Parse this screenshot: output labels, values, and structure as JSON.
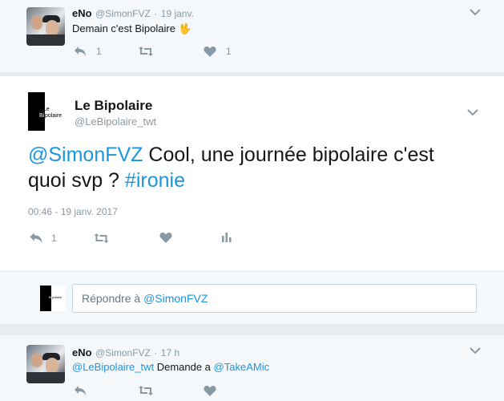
{
  "tweet_prev": {
    "name": "eNo",
    "handle": "@SimonFVZ",
    "sep": "·",
    "date": "19 janv.",
    "text": "Demain c'est Bipolaire",
    "emoji": "🖖",
    "reply_count": "1",
    "like_count": "1"
  },
  "tweet_main": {
    "name": "Le Bipolaire",
    "handle": "@LeBipolaire_twt",
    "avatar_text_white": "Le",
    "avatar_text_split_left": "Bi",
    "avatar_text_split_right": "polaire",
    "mention": "@SimonFVZ",
    "text": " Cool, une journée bipolaire c'est quoi svp ? ",
    "hashtag": "#ironie",
    "timestamp": "00:46 - 19 janv. 2017",
    "reply_count": "1"
  },
  "reply": {
    "prefix": "Répondre à ",
    "mention": "@SimonFVZ"
  },
  "tweet_next": {
    "name": "eNo",
    "handle": "@SimonFVZ",
    "sep": "·",
    "date": "17 h",
    "mention1": "@LeBipolaire_twt",
    "text": " Demande a ",
    "mention2": "@TakeAMic"
  },
  "icons": [
    "reply-icon",
    "retweet-icon",
    "heart-icon",
    "analytics-icon",
    "chevron-down-icon"
  ],
  "colors": {
    "link": "#1b95e0",
    "muted": "#8899a6",
    "panel_bg": "#f5f8fa",
    "border": "#e6ecf0"
  }
}
